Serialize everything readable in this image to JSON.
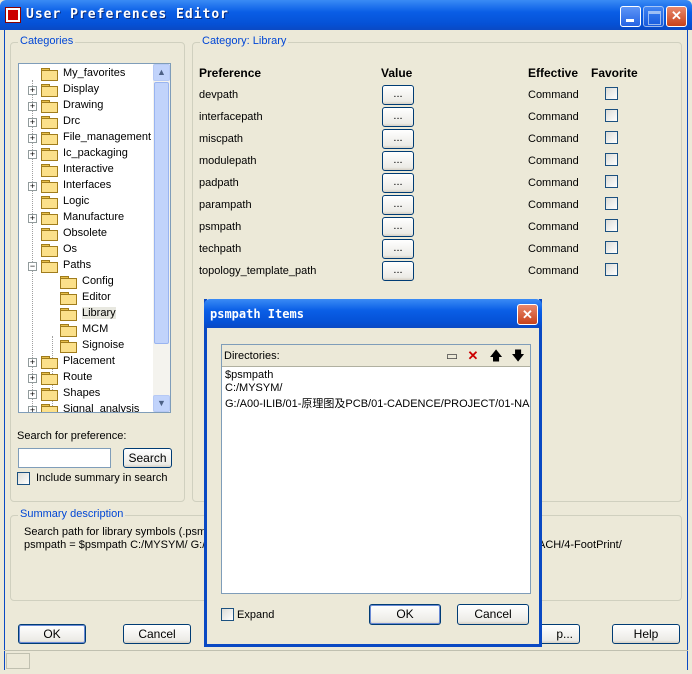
{
  "window": {
    "title": "User Preferences Editor"
  },
  "categories": {
    "label": "Categories",
    "items": [
      {
        "label": "My_favorites",
        "expander": ""
      },
      {
        "label": "Display",
        "expander": "+"
      },
      {
        "label": "Drawing",
        "expander": "+"
      },
      {
        "label": "Drc",
        "expander": "+"
      },
      {
        "label": "File_management",
        "expander": "+"
      },
      {
        "label": "Ic_packaging",
        "expander": "+"
      },
      {
        "label": "Interactive",
        "expander": ""
      },
      {
        "label": "Interfaces",
        "expander": "+"
      },
      {
        "label": "Logic",
        "expander": ""
      },
      {
        "label": "Manufacture",
        "expander": "+"
      },
      {
        "label": "Obsolete",
        "expander": ""
      },
      {
        "label": "Os",
        "expander": ""
      },
      {
        "label": "Paths",
        "expander": "−"
      },
      {
        "label": "Config",
        "expander": ""
      },
      {
        "label": "Editor",
        "expander": ""
      },
      {
        "label": "Library",
        "expander": ""
      },
      {
        "label": "MCM",
        "expander": ""
      },
      {
        "label": "Signoise",
        "expander": ""
      },
      {
        "label": "Placement",
        "expander": "+"
      },
      {
        "label": "Route",
        "expander": "+"
      },
      {
        "label": "Shapes",
        "expander": "+"
      },
      {
        "label": "Signal_analysis",
        "expander": "+"
      }
    ]
  },
  "search": {
    "label": "Search for preference:",
    "value": "",
    "button": "Search",
    "include_summary": "Include summary in search"
  },
  "category": {
    "prefix": "Category:",
    "name": "Library",
    "headers": {
      "preference": "Preference",
      "value": "Value",
      "effective": "Effective",
      "favorite": "Favorite"
    },
    "rows": [
      {
        "name": "devpath",
        "value_button": "...",
        "effective": "Command"
      },
      {
        "name": "interfacepath",
        "value_button": "...",
        "effective": "Command"
      },
      {
        "name": "miscpath",
        "value_button": "...",
        "effective": "Command"
      },
      {
        "name": "modulepath",
        "value_button": "...",
        "effective": "Command"
      },
      {
        "name": "padpath",
        "value_button": "...",
        "effective": "Command"
      },
      {
        "name": "parampath",
        "value_button": "...",
        "effective": "Command"
      },
      {
        "name": "psmpath",
        "value_button": "...",
        "effective": "Command"
      },
      {
        "name": "techpath",
        "value_button": "...",
        "effective": "Command"
      },
      {
        "name": "topology_template_path",
        "value_button": "...",
        "effective": "Command"
      }
    ]
  },
  "summary": {
    "label": "Summary description",
    "line1": "Search path for library symbols (.psm ,.d",
    "line2": "psmpath = $psmpath C:/MYSYM/ G:/",
    "line2_right": "ACH/4-FootPrint/"
  },
  "bottom": {
    "ok": "OK",
    "cancel": "Cancel",
    "help_partial": "p...",
    "help": "Help"
  },
  "dialog": {
    "title": "psmpath Items",
    "directories_label": "Directories:",
    "items": [
      "$psmpath",
      "C:/MYSYM/",
      "G:/A00-ILIB/01-原理图及PCB/01-CADENCE/PROJECT/01-NA"
    ],
    "expand": "Expand",
    "ok": "OK",
    "cancel": "Cancel",
    "tools": {
      "new": "▭",
      "delete": "✕",
      "up": "🡅",
      "down": "🡇"
    }
  }
}
